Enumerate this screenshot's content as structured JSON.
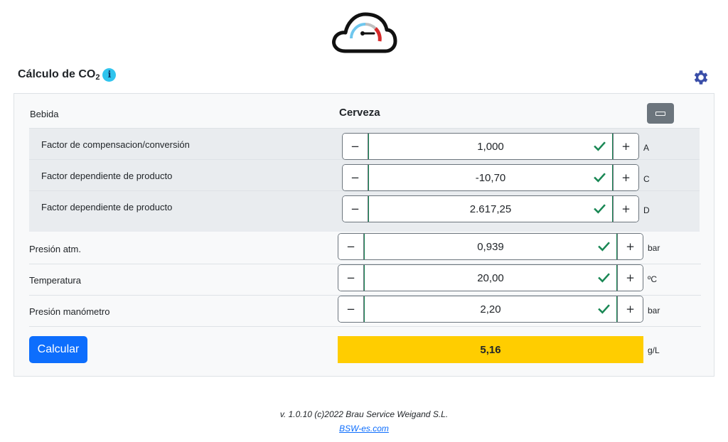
{
  "header": {
    "title": "Cálculo de CO",
    "title_sub": "2",
    "info_icon": "i"
  },
  "bebida": {
    "label": "Bebida",
    "value": "Cerveza"
  },
  "sub_factors": [
    {
      "label": "Factor de compensacion/conversión",
      "value": "1,000",
      "unit": "A"
    },
    {
      "label": "Factor dependiente de producto",
      "value": "-10,70",
      "unit": "C"
    },
    {
      "label": "Factor dependiente de producto",
      "value": "2.617,25",
      "unit": "D"
    }
  ],
  "fields": [
    {
      "label": "Presión atm.",
      "value": "0,939",
      "unit": "bar"
    },
    {
      "label": "Temperatura",
      "value": "20,00",
      "unit": "ºC"
    },
    {
      "label": "Presión manómetro",
      "value": "2,20",
      "unit": "bar"
    }
  ],
  "stepper": {
    "minus": "−",
    "plus": "+"
  },
  "calculate": {
    "button_label": "Calcular",
    "result": "5,16",
    "result_unit": "g/L"
  },
  "footer": {
    "version": "v. 1.0.10 (c)2022 Brau Service Weigand S.L.",
    "link_text": "BSW-es.com"
  },
  "colors": {
    "primary": "#0d6efd",
    "result_bg": "#ffcd00",
    "success": "#198754",
    "secondary": "#6c757d",
    "info": "#2fc4ee"
  },
  "icons": [
    "cloud-gauge-logo",
    "info-icon",
    "gear-icon",
    "check-icon",
    "collapse-icon"
  ]
}
